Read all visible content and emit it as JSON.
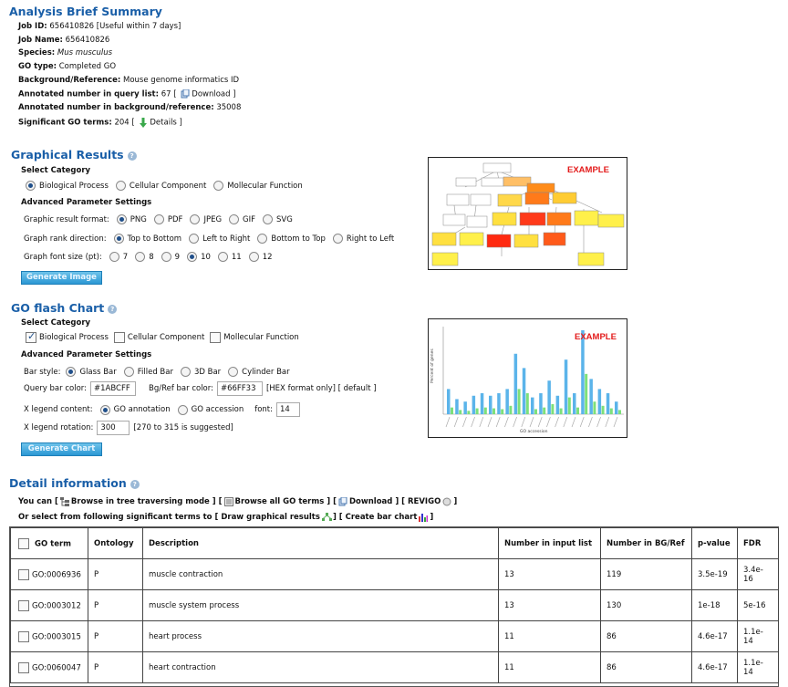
{
  "summary": {
    "title": "Analysis Brief Summary",
    "job_id_label": "Job ID:",
    "job_id": "656410826 [Useful within 7 days]",
    "job_name_label": "Job Name:",
    "job_name": "656410826",
    "species_label": "Species:",
    "species": "Mus musculus",
    "go_type_label": "GO type:",
    "go_type": "Completed GO",
    "background_label": "Background/Reference:",
    "background": "Mouse genome informatics ID",
    "annot_query_label": "Annotated number in query list:",
    "annot_query": "67 [",
    "download_label": "Download ]",
    "annot_bg_label": "Annotated number in background/reference:",
    "annot_bg": "35008",
    "sig_label": "Significant GO terms:",
    "sig": "204 [",
    "details_label": "Details ]"
  },
  "graphical": {
    "title": "Graphical Results",
    "select_category": "Select Category",
    "categories": [
      "Biological Process",
      "Cellular Component",
      "Mollecular Function"
    ],
    "advanced": "Advanced Parameter Settings",
    "format_label": "Graphic result format:",
    "formats": [
      "PNG",
      "PDF",
      "JPEG",
      "GIF",
      "SVG"
    ],
    "rank_label": "Graph rank direction:",
    "ranks": [
      "Top to Bottom",
      "Left to Right",
      "Bottom to Top",
      "Right to Left"
    ],
    "font_label": "Graph font size (pt):",
    "fonts": [
      "7",
      "8",
      "9",
      "10",
      "11",
      "12"
    ],
    "button": "Generate Image",
    "example": "EXAMPLE"
  },
  "flash": {
    "title": "GO flash Chart",
    "select_category": "Select Category",
    "categories": [
      "Biological Process",
      "Cellular Component",
      "Mollecular Function"
    ],
    "advanced": "Advanced Parameter Settings",
    "bar_style_label": "Bar style:",
    "bar_styles": [
      "Glass Bar",
      "Filled Bar",
      "3D Bar",
      "Cylinder Bar"
    ],
    "query_color_label": "Query bar color:",
    "query_color": "#1ABCFF",
    "bg_color_label": "Bg/Ref bar color:",
    "bg_color": "#66FF33",
    "hex_note": "[HEX format only] [ default ]",
    "legend_label": "X legend content:",
    "legend_opts": [
      "GO annotation",
      "GO accession"
    ],
    "font_label": "font:",
    "font_value": "14",
    "rotation_label": "X legend rotation:",
    "rotation_value": "300",
    "rotation_note": "[270 to 315 is suggested]",
    "button": "Generate Chart",
    "example": "EXAMPLE",
    "ylabel": "Percent of genes",
    "xlabel": "GO accession",
    "query_bars": [
      0.3,
      0.18,
      0.15,
      0.22,
      0.25,
      0.22,
      0.25,
      0.3,
      0.72,
      0.55,
      0.2,
      0.25,
      0.4,
      0.22,
      0.65,
      0.25,
      1.0,
      0.42,
      0.3,
      0.25,
      0.15
    ],
    "bg_bars": [
      0.08,
      0.05,
      0.04,
      0.07,
      0.08,
      0.07,
      0.06,
      0.1,
      0.3,
      0.25,
      0.06,
      0.08,
      0.12,
      0.07,
      0.2,
      0.08,
      0.48,
      0.15,
      0.1,
      0.07,
      0.05
    ],
    "colors": {
      "query": "#5bb4ea",
      "bg": "#7de07a"
    }
  },
  "detail": {
    "title": "Detail information",
    "line1_prefix": "You can [",
    "browse_tree": "Browse in tree traversing mode ] [",
    "browse_all": "Browse all GO terms ] [",
    "download": "Download ] [ REVIGO",
    "line1_suffix": "]",
    "line2_prefix": "Or select from following significant terms to [ Draw graphical results",
    "create_bar": "] [ Create bar chart",
    "line2_suffix": "]",
    "columns": [
      "GO term",
      "Ontology",
      "Description",
      "Number in input list",
      "Number in BG/Ref",
      "p-value",
      "FDR"
    ],
    "rows": [
      {
        "go": "GO:0006936",
        "ont": "P",
        "desc": "muscle contraction",
        "n": "13",
        "bg": "119",
        "p": "3.5e-19",
        "fdr": "3.4e-16"
      },
      {
        "go": "GO:0003012",
        "ont": "P",
        "desc": "muscle system process",
        "n": "13",
        "bg": "130",
        "p": "1e-18",
        "fdr": "5e-16"
      },
      {
        "go": "GO:0003015",
        "ont": "P",
        "desc": "heart process",
        "n": "11",
        "bg": "86",
        "p": "4.6e-17",
        "fdr": "1.1e-14"
      },
      {
        "go": "GO:0060047",
        "ont": "P",
        "desc": "heart contraction",
        "n": "11",
        "bg": "86",
        "p": "4.6e-17",
        "fdr": "1.1e-14"
      }
    ]
  }
}
